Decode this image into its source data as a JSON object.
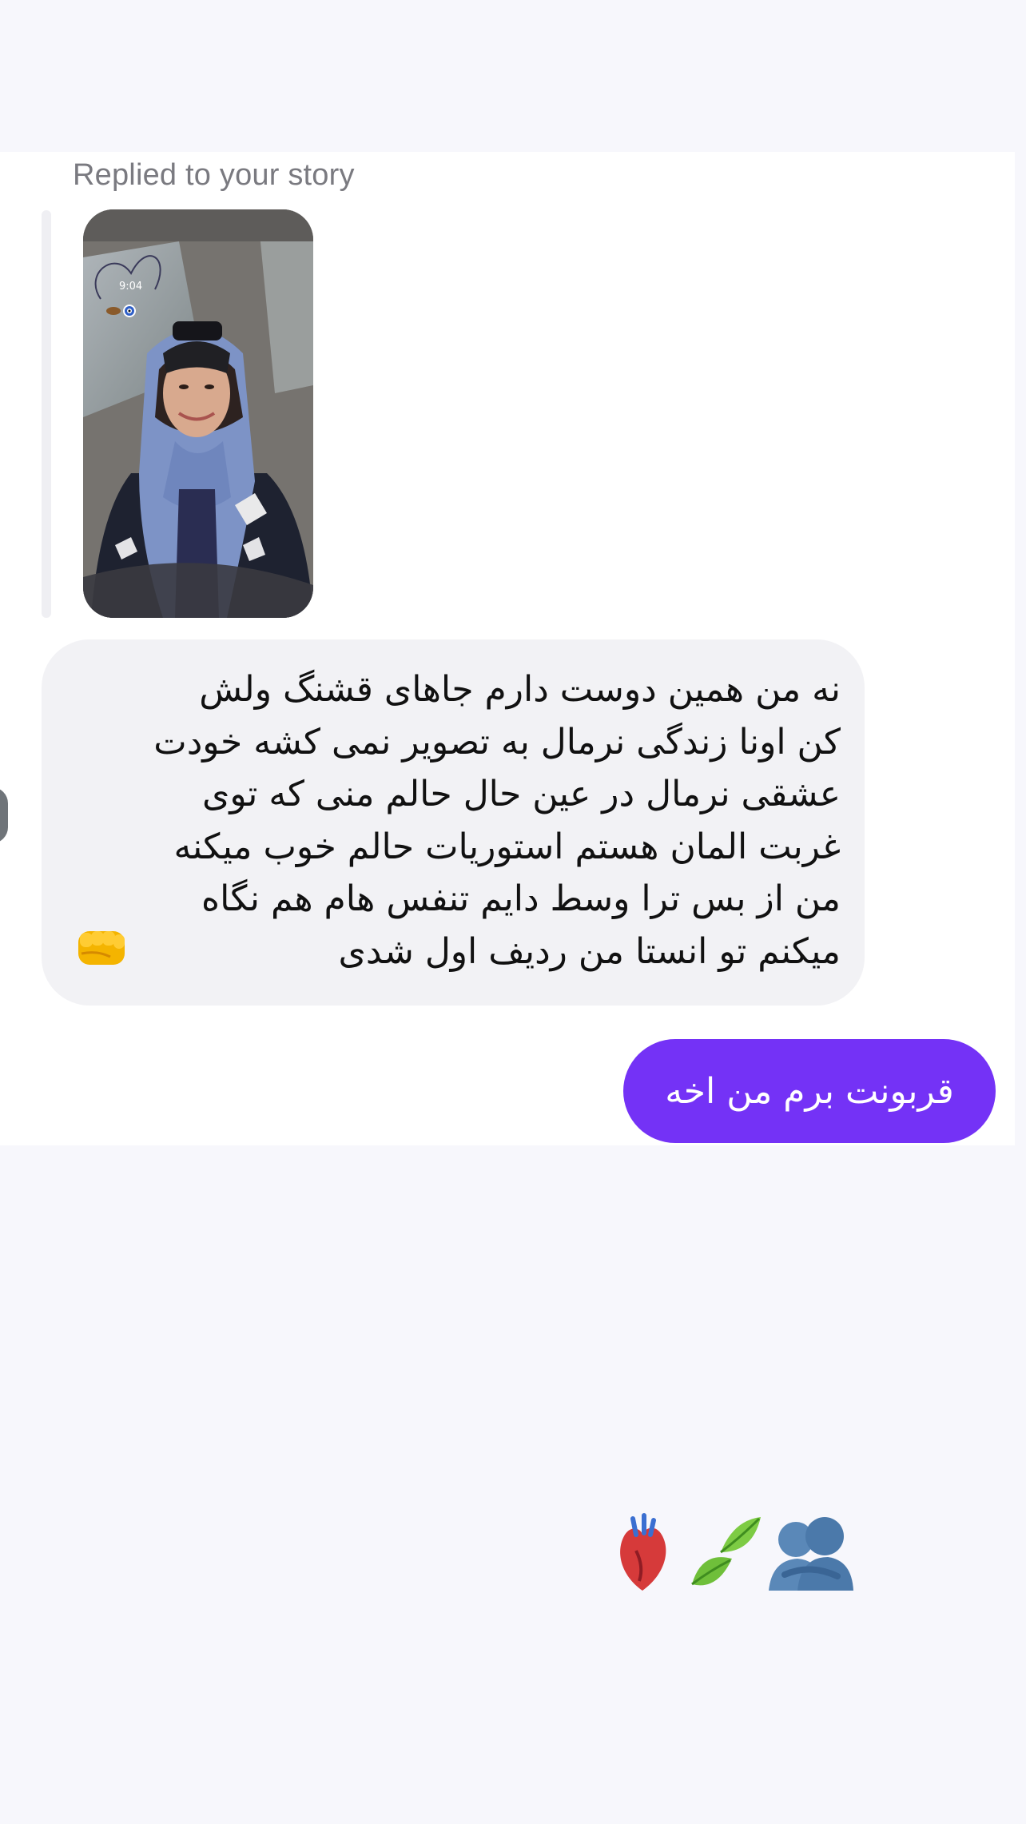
{
  "chat": {
    "reply_label": "Replied to your story",
    "story": {
      "time_sticker": "9:04"
    },
    "incoming_message": "نه من همین دوست دارم جاهای قشنگ ولش\nکن اونا زندگی نرمال به تصویر نمی کشه خودت\nعشقی نرمال در عین حال حالم منی که توی\nغربت المان هستم استوریات حالم خوب میکنه\nمن از بس ترا وسط دایم تنفس هام هم نگاه\nمیکنم تو انستا من ردیف اول شدی",
    "incoming_emoji": "oncoming-fist-icon",
    "outgoing_message": "قربونت برم من اخه"
  },
  "reactions": [
    "anatomical-heart-icon",
    "leaves-icon",
    "people-hugging-icon"
  ],
  "colors": {
    "outgoing_bubble": "#7432f6",
    "incoming_bubble": "#f2f2f5",
    "background": "#f7f7fc"
  }
}
